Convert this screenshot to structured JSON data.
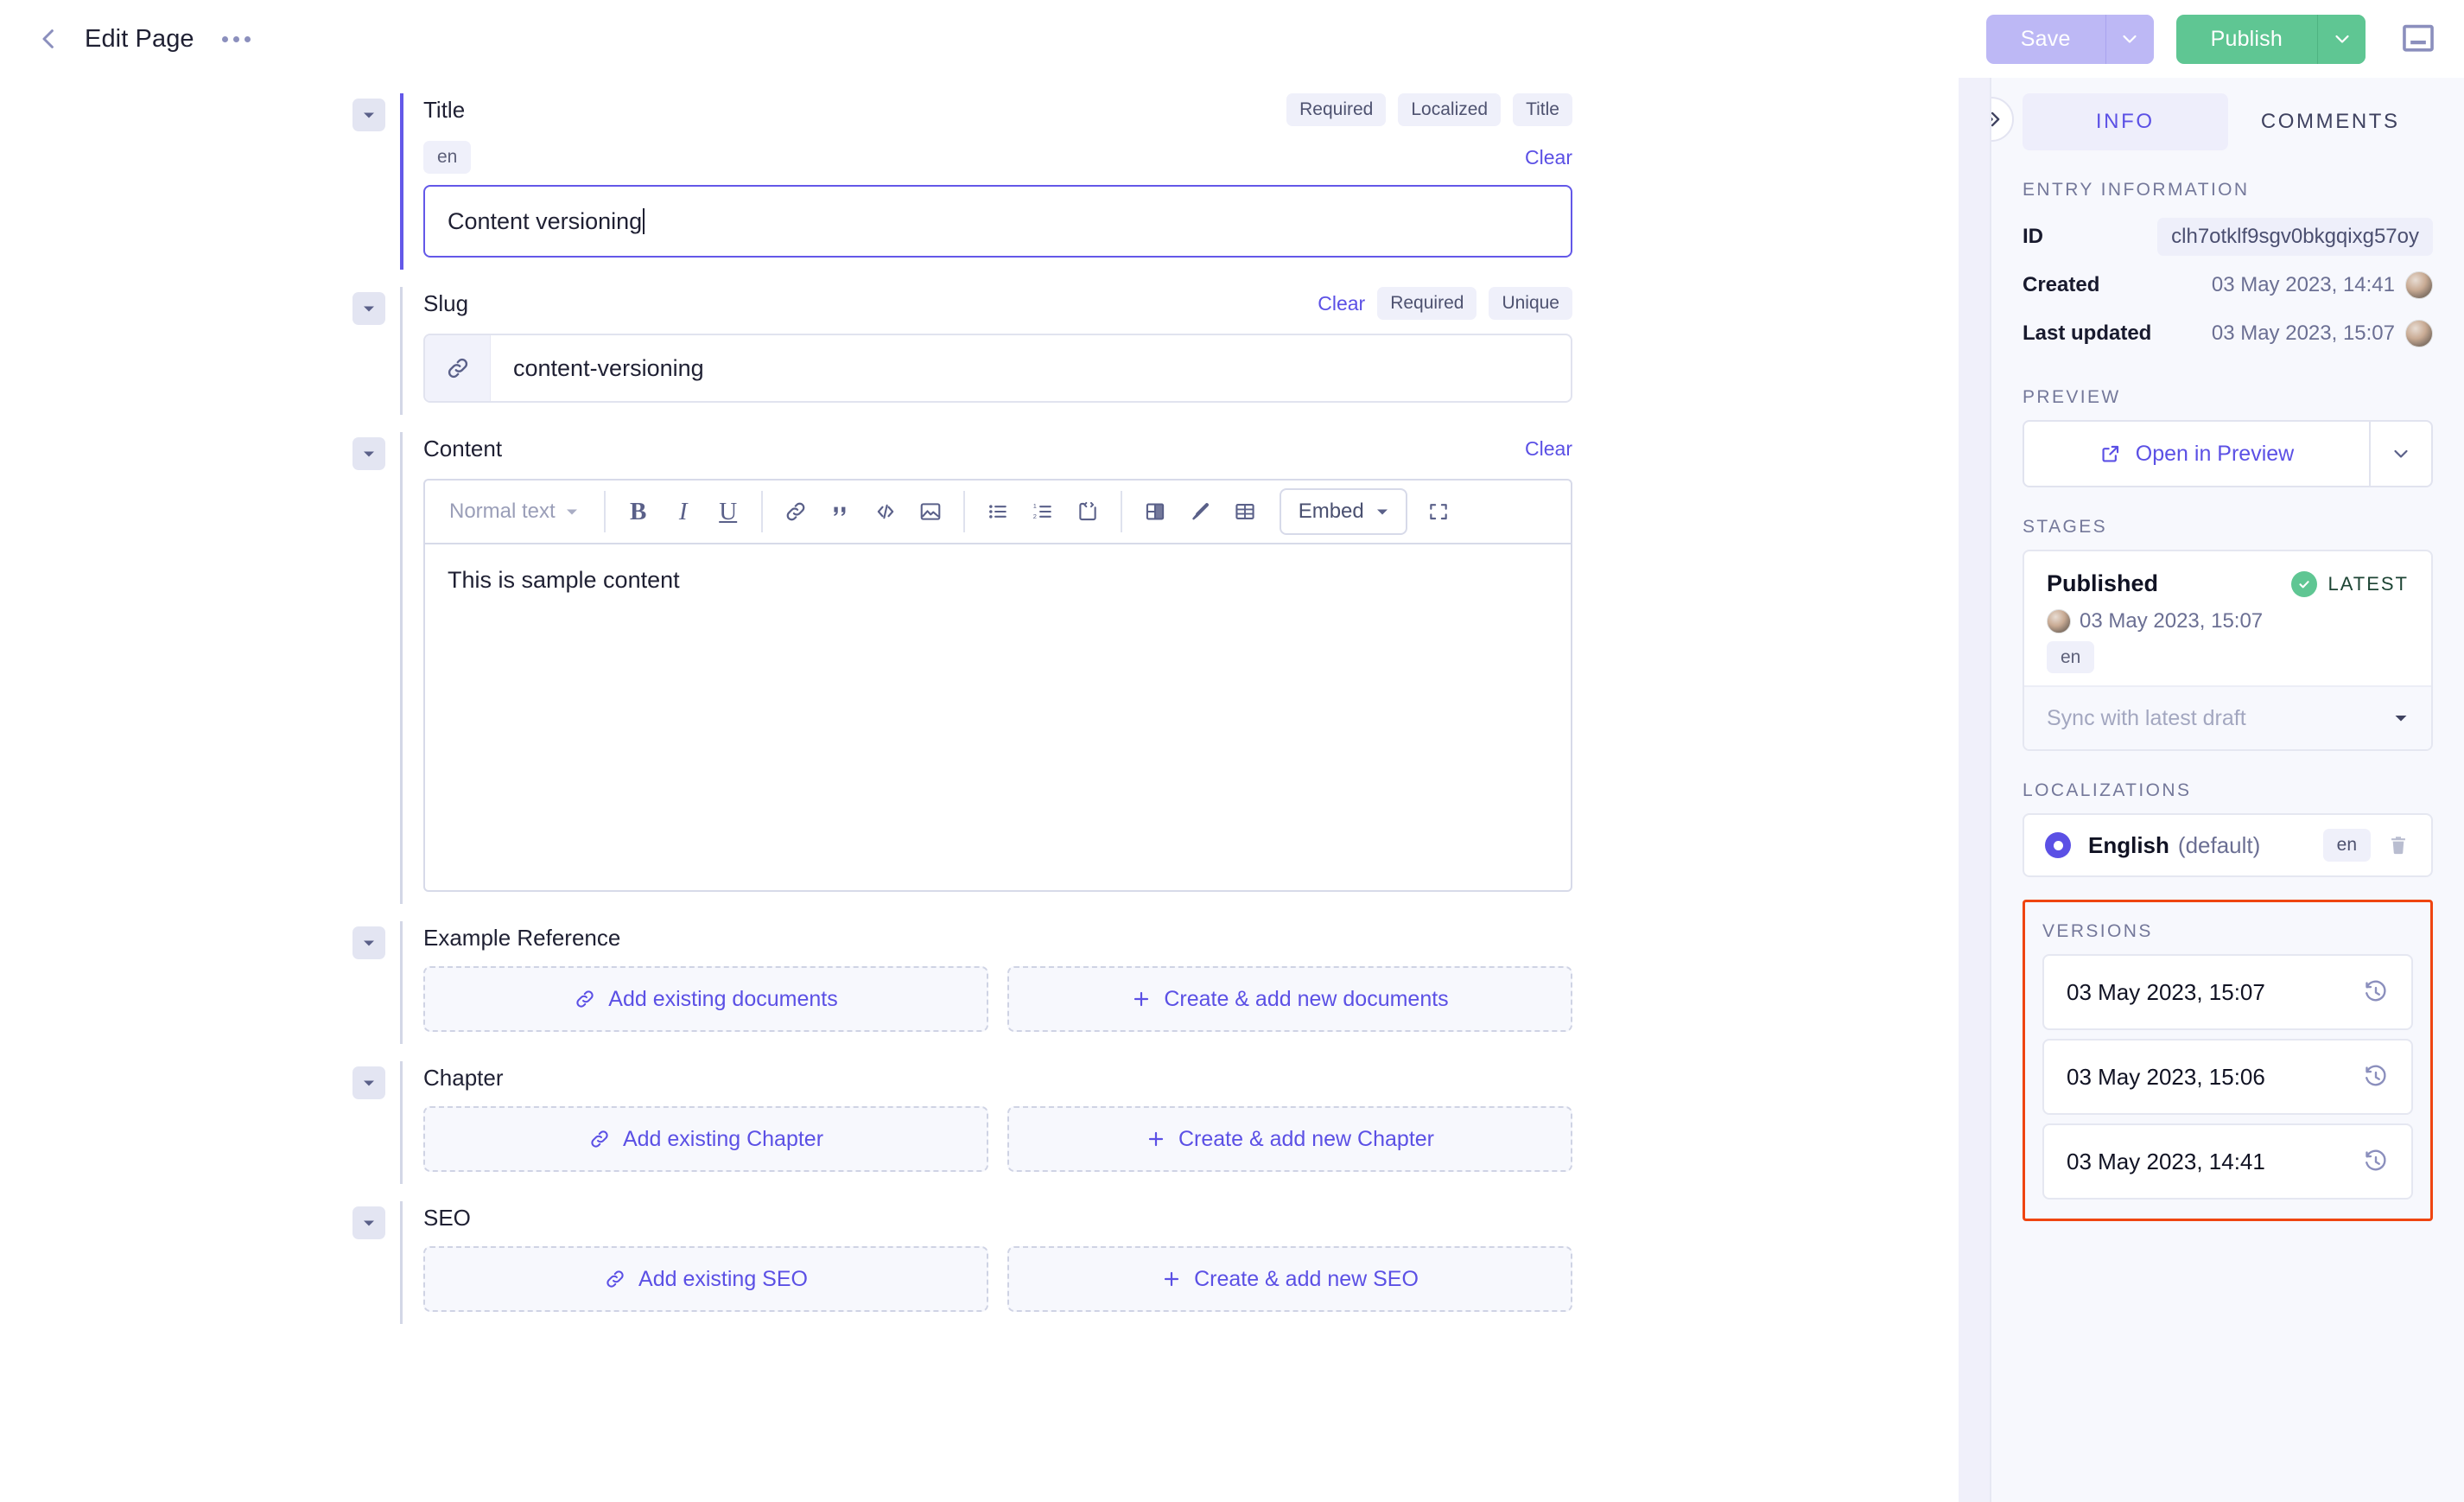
{
  "topbar": {
    "back_icon": "chevron-left-icon",
    "title": "Edit Page",
    "more_icon": "ellipsis-icon",
    "save_label": "Save",
    "publish_label": "Publish",
    "monitor_icon": "monitor-icon",
    "accent_save": "#bdb8f5",
    "accent_publish": "#5fc693"
  },
  "fields": {
    "title": {
      "label": "Title",
      "chips": [
        "Required",
        "Localized",
        "Title"
      ],
      "locale": "en",
      "clear_label": "Clear",
      "value": "Content versioning"
    },
    "slug": {
      "label": "Slug",
      "clear_label": "Clear",
      "chips": [
        "Required",
        "Unique"
      ],
      "icon": "link-icon",
      "value": "content-versioning"
    },
    "content": {
      "label": "Content",
      "clear_label": "Clear",
      "style_select": "Normal text",
      "embed_label": "Embed",
      "body_text": "This is sample content",
      "toolbar_icons": [
        "bold-icon",
        "italic-icon",
        "underline-icon",
        "link-icon",
        "quote-icon",
        "code-icon",
        "image-icon",
        "bullet-list-icon",
        "numbered-list-icon",
        "code-block-icon",
        "layout-columns-icon",
        "pen-icon",
        "table-icon",
        "fullscreen-icon"
      ]
    },
    "example_reference": {
      "label": "Example Reference",
      "add_existing": "Add existing documents",
      "create_new": "Create & add new documents"
    },
    "chapter": {
      "label": "Chapter",
      "add_existing": "Add existing Chapter",
      "create_new": "Create & add new Chapter"
    },
    "seo": {
      "label": "SEO",
      "add_existing": "Add existing SEO",
      "create_new": "Create & add new SEO"
    }
  },
  "sidebar": {
    "collapse_icon": "chevron-double-right-icon",
    "tabs": [
      {
        "label": "INFO",
        "active": true
      },
      {
        "label": "COMMENTS",
        "active": false
      }
    ],
    "entry_information": {
      "heading": "ENTRY INFORMATION",
      "id_key": "ID",
      "id_value": "clh7otklf9sgv0bkgqixg57oy",
      "created_key": "Created",
      "created_value": "03 May 2023, 14:41",
      "updated_key": "Last updated",
      "updated_value": "03 May 2023, 15:07"
    },
    "preview": {
      "heading": "PREVIEW",
      "button_label": "Open in Preview",
      "external_icon": "external-link-icon",
      "caret_icon": "chevron-down-icon"
    },
    "stages": {
      "heading": "STAGES",
      "stage_name": "Published",
      "latest_label": "LATEST",
      "latest_icon": "check-circle-icon",
      "date": "03 May 2023, 15:07",
      "locale": "en",
      "sync_label": "Sync with latest draft",
      "sync_caret_icon": "caret-down-icon"
    },
    "localizations": {
      "heading": "LOCALIZATIONS",
      "name": "English",
      "default_suffix": "(default)",
      "code": "en",
      "radio_icon": "radio-selected-icon",
      "delete_icon": "trash-icon"
    },
    "versions": {
      "heading": "VERSIONS",
      "highlight_color": "#ef4511",
      "restore_icon": "history-restore-icon",
      "items": [
        {
          "date": "03 May 2023, 15:07"
        },
        {
          "date": "03 May 2023, 15:06"
        },
        {
          "date": "03 May 2023, 14:41"
        }
      ]
    }
  }
}
